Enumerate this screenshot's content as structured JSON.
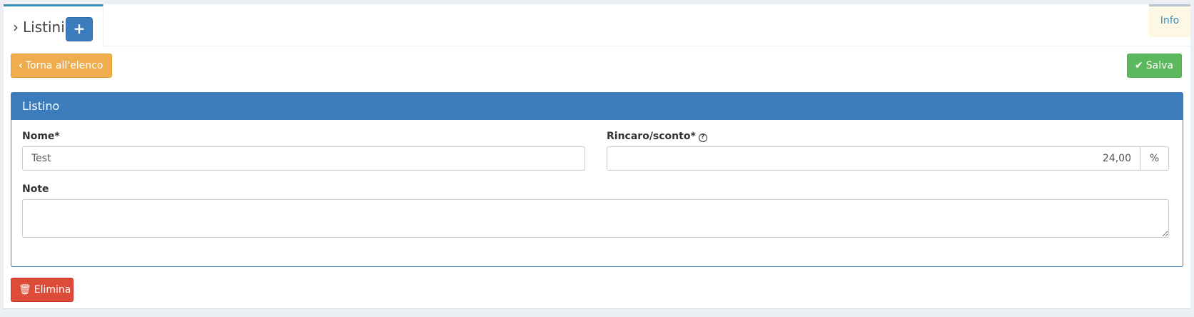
{
  "tabs": {
    "active": {
      "title": "Listini",
      "add_label": "+"
    },
    "info_label": "Info"
  },
  "toolbar": {
    "back_label": "Torna all'elenco",
    "back_icon": "chevron-left-icon",
    "save_label": "Salva",
    "save_icon": "check-icon"
  },
  "panel": {
    "title": "Listino",
    "fields": {
      "nome": {
        "label": "Nome*",
        "value": "Test"
      },
      "rincaro": {
        "label": "Rincaro/sconto*",
        "value": "24,00",
        "addon": "%",
        "help_icon": "question-circle-icon"
      },
      "note": {
        "label": "Note",
        "value": ""
      }
    }
  },
  "footer": {
    "delete_label": "Elimina",
    "delete_icon": "trash-icon"
  },
  "colors": {
    "primary": "#3c7cbc",
    "warning": "#f0ad4e",
    "success": "#5cb85c",
    "danger": "#dd4b39",
    "info_tab_bg": "#fcf8e3"
  }
}
